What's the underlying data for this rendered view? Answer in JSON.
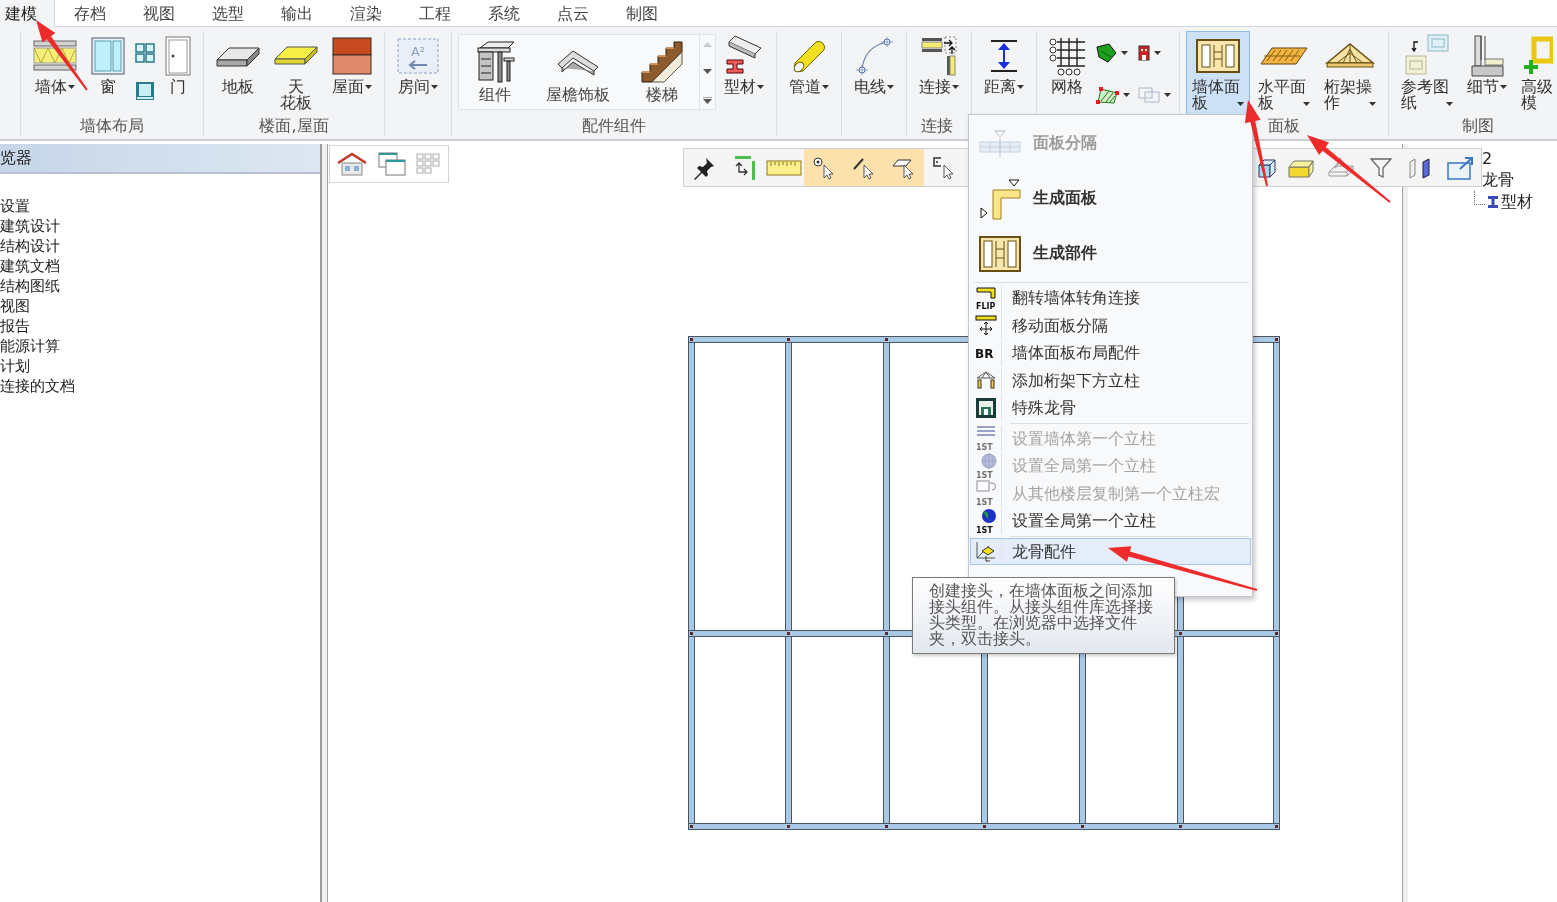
{
  "tabs": [
    {
      "label": "建模",
      "selected": true
    },
    {
      "label": "存档",
      "selected": false
    },
    {
      "label": "视图",
      "selected": false
    },
    {
      "label": "选型",
      "selected": false
    },
    {
      "label": "输出",
      "selected": false
    },
    {
      "label": "渲染",
      "selected": false
    },
    {
      "label": "工程",
      "selected": false
    },
    {
      "label": "系统",
      "selected": false
    },
    {
      "label": "点云",
      "selected": false
    },
    {
      "label": "制图",
      "selected": false
    }
  ],
  "ribbon": {
    "groups": [
      {
        "label": "墙体布局",
        "items": [
          {
            "kind": "large",
            "label": "墙体",
            "dropdown": true,
            "pressed": false
          },
          {
            "kind": "large",
            "label": "窗",
            "dropdown": false,
            "pressed": false
          },
          {
            "kind": "icon-stack",
            "buttons": [
              {
                "dropdown": false
              },
              {
                "dropdown": false
              }
            ]
          },
          {
            "kind": "large",
            "label": "门",
            "dropdown": false,
            "pressed": false
          }
        ]
      },
      {
        "label": "楼面,屋面",
        "items": [
          {
            "kind": "large",
            "label": "地板",
            "dropdown": false,
            "pressed": false
          },
          {
            "kind": "large",
            "label": "天花板",
            "dropdown": false,
            "pressed": false
          },
          {
            "kind": "large",
            "label": "屋面",
            "dropdown": true,
            "pressed": false
          }
        ]
      },
      {
        "items": [
          {
            "kind": "large",
            "label": "房间",
            "dropdown": true,
            "pressed": false,
            "icon_text": "A²"
          }
        ]
      },
      {
        "label": "配件组件",
        "items": [
          {
            "kind": "gallery",
            "entries": [
              "组件",
              "屋檐饰板",
              "楼梯"
            ],
            "can_scroll_up": false
          },
          {
            "kind": "large",
            "label": "型材",
            "dropdown": true,
            "pressed": false
          }
        ]
      },
      {
        "items": [
          {
            "kind": "large",
            "label": "管道",
            "dropdown": true,
            "pressed": false
          }
        ]
      },
      {
        "items": [
          {
            "kind": "large",
            "label": "电线",
            "dropdown": true,
            "pressed": false
          }
        ]
      },
      {
        "label": "连接",
        "items": [
          {
            "kind": "large",
            "label": "连接",
            "dropdown": true,
            "pressed": false
          }
        ]
      },
      {
        "items": [
          {
            "kind": "large",
            "label": "距离",
            "dropdown": true,
            "pressed": false
          }
        ]
      },
      {
        "items": [
          {
            "kind": "large",
            "label": "网格",
            "dropdown": false,
            "pressed": false
          },
          {
            "kind": "icon-grid",
            "buttons": [
              {
                "dropdown": true
              },
              {
                "dropdown": true
              },
              {
                "dropdown": true
              },
              {
                "dropdown": true
              }
            ]
          }
        ]
      },
      {
        "label": "面板",
        "items": [
          {
            "kind": "large",
            "label": "墙体面板",
            "dropdown": true,
            "pressed": true
          },
          {
            "kind": "large",
            "label": "水平面板",
            "dropdown": true,
            "pressed": false
          },
          {
            "kind": "large",
            "label": "桁架操作",
            "dropdown": true,
            "pressed": false
          }
        ]
      },
      {
        "label": "制图",
        "items": [
          {
            "kind": "large",
            "label": "参考图纸",
            "dropdown": true,
            "pressed": false
          },
          {
            "kind": "large",
            "label": "细节",
            "dropdown": true,
            "pressed": false
          },
          {
            "kind": "large",
            "label": "高级模",
            "dropdown": false,
            "pressed": false
          }
        ]
      }
    ]
  },
  "browser": {
    "title": "览器",
    "items": [
      "设置",
      "建筑设计",
      "结构设计",
      "建筑文档",
      "结构图纸",
      "视图",
      "报告",
      "能源计算",
      "计划",
      "连接的文档"
    ]
  },
  "floating_toolbar": {
    "tools": [
      {
        "active": false
      },
      {
        "active": false
      },
      {
        "active": false
      },
      {
        "active": true
      },
      {
        "active": true
      },
      {
        "active": true
      },
      {
        "active": false
      },
      {
        "active": false
      },
      {
        "active": false
      },
      {
        "active": false
      },
      {
        "active": false
      },
      {
        "active": false
      },
      {
        "active": false
      }
    ]
  },
  "project_tree": {
    "items": [
      {
        "label": "2"
      },
      {
        "label": "龙骨",
        "children": [
          {
            "label": "型材"
          }
        ]
      }
    ]
  },
  "panel_menu": {
    "sections": [
      [
        {
          "kind": "large",
          "label": "面板分隔",
          "disabled": true,
          "highlighted": false
        },
        {
          "kind": "large",
          "label": "生成面板",
          "disabled": false,
          "highlighted": false
        },
        {
          "kind": "large",
          "label": "生成部件",
          "disabled": false,
          "highlighted": false
        }
      ],
      [
        {
          "kind": "small",
          "label": "翻转墙体转角连接",
          "icon_text": "FLIP",
          "disabled": false,
          "highlighted": false
        },
        {
          "kind": "small",
          "label": "移动面板分隔",
          "disabled": false,
          "highlighted": false
        },
        {
          "kind": "small",
          "label": "墙体面板布局配件",
          "icon_text": "BR",
          "disabled": false,
          "highlighted": false
        },
        {
          "kind": "small",
          "label": "添加桁架下方立柱",
          "disabled": false,
          "highlighted": false
        },
        {
          "kind": "small",
          "label": "特殊龙骨",
          "disabled": false,
          "highlighted": false
        }
      ],
      [
        {
          "kind": "small",
          "label": "设置墙体第一个立柱",
          "icon_text": "1ST",
          "disabled": true,
          "highlighted": false
        },
        {
          "kind": "small",
          "label": "设置全局第一个立柱",
          "icon_text": "1ST",
          "disabled": true,
          "highlighted": false
        },
        {
          "kind": "small",
          "label": "从其他楼层复制第一个立柱宏",
          "icon_text": "1ST",
          "disabled": true,
          "highlighted": false
        },
        {
          "kind": "small",
          "label": "设置全局第一个立柱",
          "icon_text": "1ST",
          "disabled": false,
          "highlighted": false
        }
      ],
      [
        {
          "kind": "small",
          "label": "龙骨配件",
          "disabled": false,
          "highlighted": true
        }
      ]
    ]
  },
  "tooltip": {
    "text": "创建接头，在墙体面板之间添加接头组件。从接头组件库选择接头类型。在浏览器中选择文件夹，双击接头。"
  }
}
